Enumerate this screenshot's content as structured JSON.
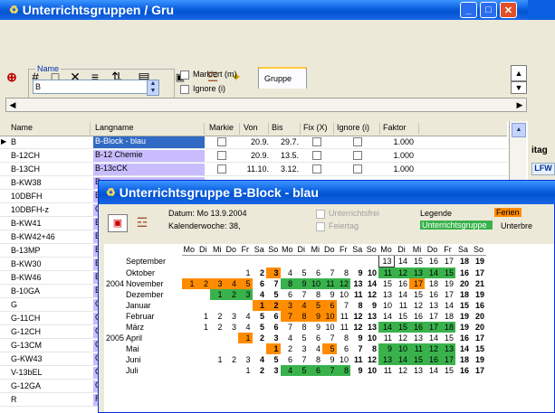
{
  "bg_window": {
    "title": "Unterrichtsgruppen / Gru",
    "name_label": "Name",
    "name_value": "B",
    "cb_markiert": "Markiert (m)",
    "cb_ignore": "Ignore (i)",
    "tab_gruppe": "Gruppe",
    "columns": [
      "Name",
      "Langname",
      "Markie",
      "Von",
      "Bis",
      "Fix (X)",
      "Ignore (i)",
      "Faktor"
    ],
    "rows": [
      {
        "name": "B",
        "lang": "B-Block - blau",
        "von": "20.9.",
        "bis": "29.7.",
        "faktor": "1.000",
        "selected": true
      },
      {
        "name": "B-12CH",
        "lang": "B-12 Chemie",
        "von": "20.9.",
        "bis": "13.5.",
        "faktor": "1.000"
      },
      {
        "name": "B-13CH",
        "lang": "B-13cCK",
        "von": "11.10.",
        "bis": "3.12.",
        "faktor": "1.000"
      },
      {
        "name": "B-KW38",
        "lang": "B-",
        "faktor": ""
      },
      {
        "name": "10DBFH",
        "lang": "B-1",
        "faktor": ""
      },
      {
        "name": "10DBFH-z",
        "lang": "G-",
        "faktor": ""
      },
      {
        "name": "B-KW41",
        "lang": "B-1",
        "faktor": ""
      },
      {
        "name": "B-KW42+46",
        "lang": "B-",
        "faktor": ""
      },
      {
        "name": "B-13MP",
        "lang": "B-1",
        "faktor": ""
      },
      {
        "name": "B-KW30",
        "lang": "B o",
        "faktor": ""
      },
      {
        "name": "B-KW46",
        "lang": "B o",
        "faktor": ""
      },
      {
        "name": "B-10GA",
        "lang": "B-1",
        "faktor": ""
      },
      {
        "name": "G",
        "lang": "G-E",
        "faktor": ""
      },
      {
        "name": "G-11CH",
        "lang": "G-1",
        "faktor": ""
      },
      {
        "name": "G-12CH",
        "lang": "G-1",
        "faktor": ""
      },
      {
        "name": "G-13CM",
        "lang": "G-1",
        "faktor": ""
      },
      {
        "name": "G-KW43",
        "lang": "G-",
        "faktor": ""
      },
      {
        "name": "V-13bEL",
        "lang": "G-1",
        "faktor": ""
      },
      {
        "name": "G-12GA",
        "lang": "G-1",
        "faktor": ""
      },
      {
        "name": "R",
        "lang": "R-B",
        "faktor": ""
      }
    ],
    "right_frag_col": "itag",
    "right_frag_val": "LFW"
  },
  "fg_window": {
    "title": "Unterrichtsgruppe B-Block - blau",
    "datum": "Datum: Mo 13.9.2004",
    "kalenderwoche": "Kalenderwoche: 38,",
    "unterrichtsfrei": "Unterrichtsfrei",
    "feiertag": "Feiertag",
    "legende": "Legende",
    "ferien": "Ferien",
    "unterrichtsgruppe": "Unterrichtsgruppe",
    "unterbrechung": "Unterbre"
  },
  "calendar": {
    "day_headers": [
      "Mo",
      "Di",
      "Mi",
      "Do",
      "Fr",
      "Sa",
      "So",
      "Mo",
      "Di",
      "Mi",
      "Do",
      "Fr",
      "Sa",
      "So",
      "Mo",
      "Di",
      "Mi",
      "Do",
      "Fr",
      "Sa",
      "So"
    ],
    "months": [
      {
        "year": "",
        "month": "September",
        "days": [
          "",
          "",
          "",
          "",
          "",
          "",
          "",
          "",
          "",
          "",
          "",
          "",
          "",
          "",
          "13",
          "14",
          "15",
          "16",
          "17",
          "18",
          "19"
        ],
        "colors": [
          "",
          "",
          "",
          "",
          "",
          "",
          "",
          "",
          "",
          "",
          "",
          "",
          "",
          "",
          "",
          "",
          "",
          "",
          "",
          "",
          ""
        ]
      },
      {
        "year": "",
        "month": "Oktober",
        "days": [
          "",
          "",
          "",
          "",
          "1",
          "2",
          "3",
          "4",
          "5",
          "6",
          "7",
          "8",
          "9",
          "10",
          "11",
          "12",
          "13",
          "14",
          "15",
          "16",
          "17"
        ],
        "colors": [
          "",
          "",
          "",
          "",
          "",
          "",
          "o",
          "",
          "",
          "",
          "",
          "",
          "",
          "",
          "g",
          "g",
          "g",
          "g",
          "g",
          "",
          ""
        ]
      },
      {
        "year": "2004",
        "month": "November",
        "days": [
          "1",
          "2",
          "3",
          "4",
          "5",
          "6",
          "7",
          "8",
          "9",
          "10",
          "11",
          "12",
          "13",
          "14",
          "15",
          "16",
          "17",
          "18",
          "19",
          "20",
          "21"
        ],
        "colors": [
          "o",
          "o",
          "o",
          "o",
          "o",
          "",
          "",
          "g",
          "g",
          "g",
          "g",
          "g",
          "",
          "",
          "",
          "",
          "o",
          "",
          "",
          "",
          ""
        ]
      },
      {
        "year": "",
        "month": "Dezember",
        "days": [
          "",
          "",
          "1",
          "2",
          "3",
          "4",
          "5",
          "6",
          "7",
          "8",
          "9",
          "10",
          "11",
          "12",
          "13",
          "14",
          "15",
          "16",
          "17",
          "18",
          "19"
        ],
        "colors": [
          "",
          "",
          "g",
          "g",
          "g",
          "",
          "",
          "",
          "",
          "",
          "",
          "",
          "",
          "",
          "",
          "",
          "",
          "",
          "",
          "",
          ""
        ]
      },
      {
        "year": "",
        "month": "Januar",
        "days": [
          "",
          "",
          "",
          "",
          "",
          "1",
          "2",
          "3",
          "4",
          "5",
          "6",
          "7",
          "8",
          "9",
          "10",
          "11",
          "12",
          "13",
          "14",
          "15",
          "16"
        ],
        "colors": [
          "",
          "",
          "",
          "",
          "",
          "o",
          "o",
          "o",
          "o",
          "o",
          "o",
          "",
          "",
          "",
          "",
          "",
          "",
          "",
          "",
          "",
          ""
        ]
      },
      {
        "year": "",
        "month": "Februar",
        "days": [
          "",
          "1",
          "2",
          "3",
          "4",
          "5",
          "6",
          "7",
          "8",
          "9",
          "10",
          "11",
          "12",
          "13",
          "14",
          "15",
          "16",
          "17",
          "18",
          "19",
          "20"
        ],
        "colors": [
          "",
          "",
          "",
          "",
          "",
          "",
          "",
          "o",
          "o",
          "o",
          "o",
          "",
          "",
          "",
          "",
          "",
          "",
          "",
          "",
          "",
          ""
        ]
      },
      {
        "year": "",
        "month": "März",
        "days": [
          "",
          "1",
          "2",
          "3",
          "4",
          "5",
          "6",
          "7",
          "8",
          "9",
          "10",
          "11",
          "12",
          "13",
          "14",
          "15",
          "16",
          "17",
          "18",
          "19",
          "20"
        ],
        "colors": [
          "",
          "",
          "",
          "",
          "",
          "",
          "",
          "",
          "",
          "",
          "",
          "",
          "",
          "",
          "g",
          "g",
          "g",
          "g",
          "g",
          "",
          ""
        ]
      },
      {
        "year": "2005",
        "month": "April",
        "days": [
          "",
          "",
          "",
          "",
          "1",
          "2",
          "3",
          "4",
          "5",
          "6",
          "7",
          "8",
          "9",
          "10",
          "11",
          "12",
          "13",
          "14",
          "15",
          "16",
          "17"
        ],
        "colors": [
          "",
          "",
          "",
          "",
          "o",
          "",
          "",
          "",
          "",
          "",
          "",
          "",
          "",
          "",
          "",
          "",
          "",
          "",
          "",
          "",
          ""
        ]
      },
      {
        "year": "",
        "month": "Mai",
        "days": [
          "",
          "",
          "",
          "",
          "",
          "",
          "1",
          "2",
          "3",
          "4",
          "5",
          "6",
          "7",
          "8",
          "9",
          "10",
          "11",
          "12",
          "13",
          "14",
          "15"
        ],
        "colors": [
          "",
          "",
          "",
          "",
          "",
          "",
          "o",
          "",
          "",
          "",
          "o",
          "",
          "",
          "",
          "g",
          "g",
          "g",
          "g",
          "g",
          "",
          ""
        ]
      },
      {
        "year": "",
        "month": "Juni",
        "days": [
          "",
          "",
          "1",
          "2",
          "3",
          "4",
          "5",
          "6",
          "7",
          "8",
          "9",
          "10",
          "11",
          "12",
          "13",
          "14",
          "15",
          "16",
          "17",
          "18",
          "19"
        ],
        "colors": [
          "",
          "",
          "",
          "",
          "",
          "",
          "",
          "",
          "",
          "",
          "",
          "",
          "",
          "",
          "g",
          "g",
          "g",
          "g",
          "g",
          "",
          ""
        ]
      },
      {
        "year": "",
        "month": "Juli",
        "days": [
          "",
          "",
          "",
          "",
          "1",
          "2",
          "3",
          "4",
          "5",
          "6",
          "7",
          "8",
          "9",
          "10",
          "11",
          "12",
          "13",
          "14",
          "15",
          "16",
          "17"
        ],
        "colors": [
          "",
          "",
          "",
          "",
          "",
          "",
          "",
          "g",
          "g",
          "g",
          "g",
          "g",
          "",
          "",
          "",
          "",
          "",
          "",
          "",
          "",
          ""
        ]
      }
    ]
  },
  "colors": {
    "orange": "#ff8c00",
    "green": "#39b24c",
    "title_blue": "#0a5fe0"
  }
}
